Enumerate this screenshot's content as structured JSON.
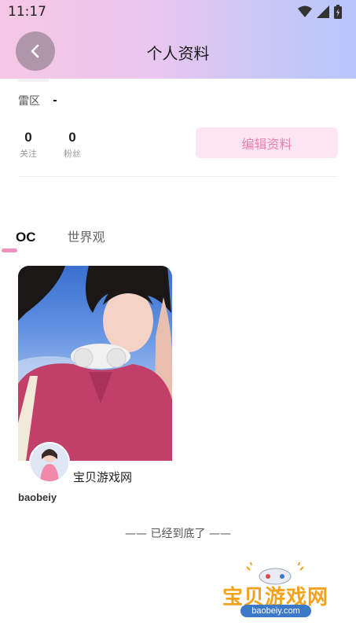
{
  "status_bar": {
    "time": "11:17"
  },
  "header": {
    "title": "个人资料"
  },
  "profile": {
    "region_label": "雷区",
    "region_value": "-",
    "following_count": "0",
    "following_label": "关注",
    "followers_count": "0",
    "followers_label": "粉丝",
    "edit_button_label": "编辑资料"
  },
  "tabs": [
    {
      "label": "OC",
      "active": true
    },
    {
      "label": "世界观",
      "active": false
    }
  ],
  "cards": [
    {
      "name": "宝贝游戏网",
      "username": "baobeiy"
    }
  ],
  "footer": {
    "end_text": "—— 已经到底了 ——"
  },
  "watermark": {
    "title": "宝贝游戏网",
    "url": "baobeiy.com"
  },
  "colors": {
    "accent_pink": "#f38fbc",
    "edit_button_bg": "#fde6f1",
    "edit_button_text": "#ec7fae"
  }
}
